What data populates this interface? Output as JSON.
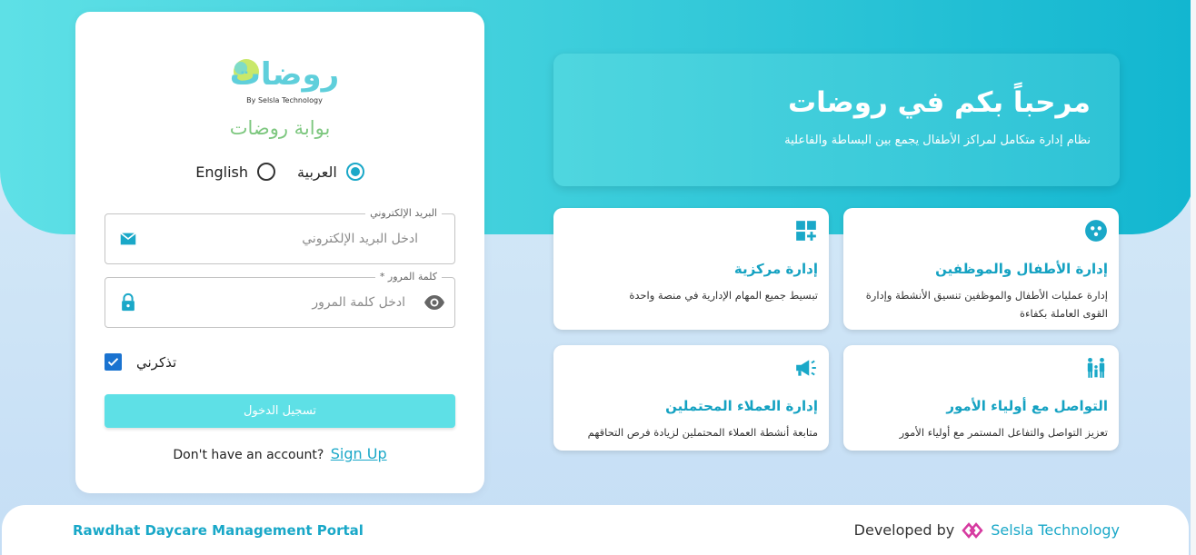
{
  "login": {
    "logo_arabic": "روضات",
    "logo_sub": "By Selsla Technology",
    "portal_title": "بوابة روضات",
    "languages": [
      {
        "label": "العربية",
        "checked": true
      },
      {
        "label": "English",
        "checked": false
      }
    ],
    "email": {
      "label": "البريد الإلكتروني",
      "placeholder": "ادخل البريد الإلكتروني"
    },
    "password": {
      "label": "* كلمة المرور",
      "placeholder": "ادخل كلمة المرور"
    },
    "remember_label": "تذكرني",
    "login_button": "تسجيل الدخول",
    "no_account": "Don't have an account?",
    "signup_link": "Sign Up"
  },
  "welcome": {
    "title": "مرحباً بكم في روضات",
    "subtitle": "نظام إدارة متكامل لمراكز الأطفال يجمع بين البساطة والفاعلية"
  },
  "features": [
    {
      "icon": "group-icon",
      "title": "إدارة الأطفال والموظفين",
      "desc": "إدارة عمليات الأطفال والموظفين تنسيق الأنشطة وإدارة القوى العاملة بكفاءة"
    },
    {
      "icon": "grid-plus-icon",
      "title": "إدارة مركزية",
      "desc": "تبسيط جميع المهام الإدارية في منصة واحدة"
    },
    {
      "icon": "family-icon",
      "title": "التواصل مع أولياء الأمور",
      "desc": "تعزيز التواصل والتفاعل المستمر مع أولياء الأمور"
    },
    {
      "icon": "megaphone-icon",
      "title": "إدارة العملاء المحتملين",
      "desc": "متابعة أنشطة العملاء المحتملين لزيادة فرص التحاقهم"
    }
  ],
  "footer": {
    "left": "Rawdhat Daycare Management Portal",
    "developed_by": "Developed by",
    "brand": "Selsla Technology"
  },
  "colors": {
    "accent": "#1aa8c8",
    "button": "#5ee0e6",
    "logo_green": "#7dc77f"
  }
}
